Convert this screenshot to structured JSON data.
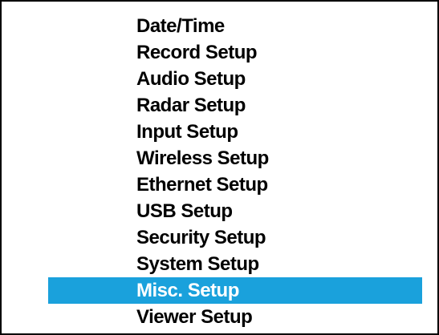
{
  "menu": {
    "selected_index": 10,
    "items": [
      {
        "label": "Date/Time"
      },
      {
        "label": "Record Setup"
      },
      {
        "label": "Audio Setup"
      },
      {
        "label": "Radar Setup"
      },
      {
        "label": "Input Setup"
      },
      {
        "label": "Wireless Setup"
      },
      {
        "label": "Ethernet Setup"
      },
      {
        "label": "USB Setup"
      },
      {
        "label": "Security Setup"
      },
      {
        "label": "System Setup"
      },
      {
        "label": "Misc. Setup"
      },
      {
        "label": "Viewer Setup"
      }
    ]
  },
  "colors": {
    "highlight": "#1aa1dc",
    "text": "#000000",
    "selected_text": "#ffffff",
    "background": "#ffffff",
    "border": "#000000"
  }
}
